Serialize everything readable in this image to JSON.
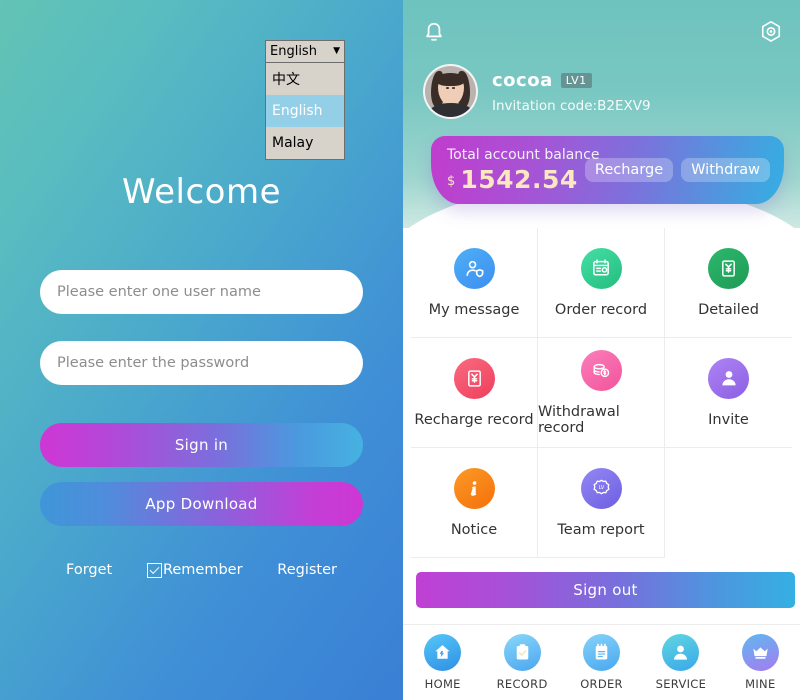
{
  "login": {
    "language": {
      "selected": "English",
      "chevron": "chevron-down-icon",
      "options": [
        {
          "label": "中文",
          "selected": false
        },
        {
          "label": "English",
          "selected": true
        },
        {
          "label": "Malay",
          "selected": false
        }
      ]
    },
    "title": "Welcome",
    "username_placeholder": "Please enter one user name",
    "username_value": "",
    "password_placeholder": "Please enter the password",
    "password_value": "",
    "signin_label": "Sign in",
    "appdownload_label": "App Download",
    "forget_label": "Forget",
    "remember_label": "Remember",
    "remember_checked": true,
    "register_label": "Register"
  },
  "account": {
    "bell_icon": "bell-icon",
    "gear_icon": "gear-icon",
    "username": "cocoa",
    "level_badge": "LV1",
    "invitation_code": "Invitation code:B2EXV9",
    "balance": {
      "label": "Total account balance",
      "currency": "$",
      "amount": "1542.54",
      "recharge_label": "Recharge",
      "withdraw_label": "Withdraw"
    },
    "menu": [
      {
        "label": "My message",
        "icon": "user-shield-icon",
        "color": "#3d9bf0",
        "color2": "#4fb0f5",
        "glyph": "person-shield"
      },
      {
        "label": "Order record",
        "icon": "order-list-icon",
        "color": "#2ecc8f",
        "color2": "#3fd6a4",
        "glyph": "receipt"
      },
      {
        "label": "Detailed",
        "icon": "detail-yen-icon",
        "color": "#22a45d",
        "color2": "#2cb86d",
        "glyph": "envelope-yen"
      },
      {
        "label": "Recharge record",
        "icon": "red-envelope-icon",
        "color": "#f4506a",
        "color2": "#f76277",
        "glyph": "envelope-yen"
      },
      {
        "label": "Withdrawal record",
        "icon": "money-stack-icon",
        "color": "#f562a6",
        "color2": "#fa77b5",
        "glyph": "coins"
      },
      {
        "label": "Invite",
        "icon": "invite-person-icon",
        "color": "#9a6ae8",
        "color2": "#a97cf0",
        "glyph": "person"
      },
      {
        "label": "Notice",
        "icon": "info-icon",
        "color": "#f77b14",
        "color2": "#fb9320",
        "glyph": "info"
      },
      {
        "label": "Team report",
        "icon": "team-level-icon",
        "color": "#7b6fe8",
        "color2": "#8f82f2",
        "glyph": "lv-badge"
      }
    ],
    "signout_label": "Sign out",
    "bottom_nav": [
      {
        "label": "HOME",
        "icon": "home-icon",
        "c1": "#4fc3f7",
        "c2": "#2f8fe5",
        "glyph": "home"
      },
      {
        "label": "RECORD",
        "icon": "clipboard-icon",
        "c1": "#82d4f8",
        "c2": "#4aa6ef",
        "glyph": "clipboard"
      },
      {
        "label": "ORDER",
        "icon": "notes-icon",
        "c1": "#7fd0f7",
        "c2": "#49a7f0",
        "glyph": "notes"
      },
      {
        "label": "SERVICE",
        "icon": "person-icon",
        "c1": "#5fd3e0",
        "c2": "#39a8e8",
        "glyph": "person"
      },
      {
        "label": "MINE",
        "icon": "crown-icon",
        "c1": "#5fb8f0",
        "c2": "#a57bf0",
        "glyph": "crown"
      }
    ]
  }
}
